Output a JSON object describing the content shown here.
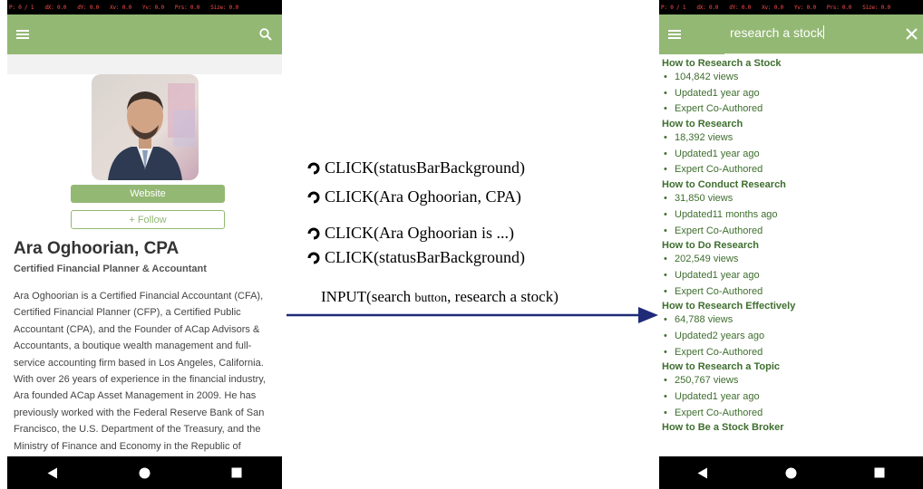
{
  "status_debug": [
    "P: 0 / 1",
    "dX: 0.0",
    "dY: 0.0",
    "Xv: 0.0",
    "Yv: 0.0",
    "Prs: 0.0",
    "Size: 0.0"
  ],
  "colors": {
    "appbar": "#93b874",
    "link": "#3e6e2e",
    "arrow": "#1f2a78"
  },
  "icons": {
    "menu": "hamburger-icon",
    "search": "search-icon",
    "close": "close-icon",
    "back": "back-triangle-icon",
    "home": "home-circle-icon",
    "recents": "recents-square-icon"
  },
  "left": {
    "website_label": "Website",
    "follow_label": "+ Follow",
    "name": "Ara Oghoorian, CPA",
    "title": "Certified Financial Planner & Accountant",
    "bio": "Ara Oghoorian is a Certified Financial Accountant (CFA), Certified Financial Planner (CFP), a Certified Public Accountant (CPA), and the Founder of ACap Advisors & Accountants, a boutique wealth management and full-service accounting firm based in Los Angeles, California. With over 26 years of experience in the financial industry, Ara founded ACap Asset Management in 2009. He has previously worked with the Federal Reserve Bank of San Francisco, the U.S. Department of the Treasury, and the Ministry of Finance and Economy in the Republic of Armenia."
  },
  "actions": [
    "CLICK(statusBarBackground)",
    "CLICK(Ara Oghoorian, CPA)",
    "CLICK(Ara Oghoorian is ...)",
    "CLICK(statusBarBackground)"
  ],
  "input_action": {
    "prefix": "INPUT(search ",
    "small": "button",
    "suffix": ", research a stock)"
  },
  "right": {
    "search_value": "research a stock",
    "results": [
      {
        "title": "How to Research a Stock",
        "views": "104,842 views",
        "updated": "Updated1 year ago",
        "badge": "Expert Co-Authored"
      },
      {
        "title": "How to Research",
        "views": "18,392 views",
        "updated": "Updated1 year ago",
        "badge": "Expert Co-Authored"
      },
      {
        "title": "How to Conduct Research",
        "views": "31,850 views",
        "updated": "Updated11 months ago",
        "badge": "Expert Co-Authored"
      },
      {
        "title": "How to Do Research",
        "views": "202,549 views",
        "updated": "Updated1 year ago",
        "badge": "Expert Co-Authored"
      },
      {
        "title": "How to Research Effectively",
        "views": "64,788 views",
        "updated": "Updated2 years ago",
        "badge": "Expert Co-Authored"
      },
      {
        "title": "How to Research a Topic",
        "views": "250,767 views",
        "updated": "Updated1 year ago",
        "badge": "Expert Co-Authored"
      },
      {
        "title": "How to Be a Stock Broker"
      }
    ]
  }
}
